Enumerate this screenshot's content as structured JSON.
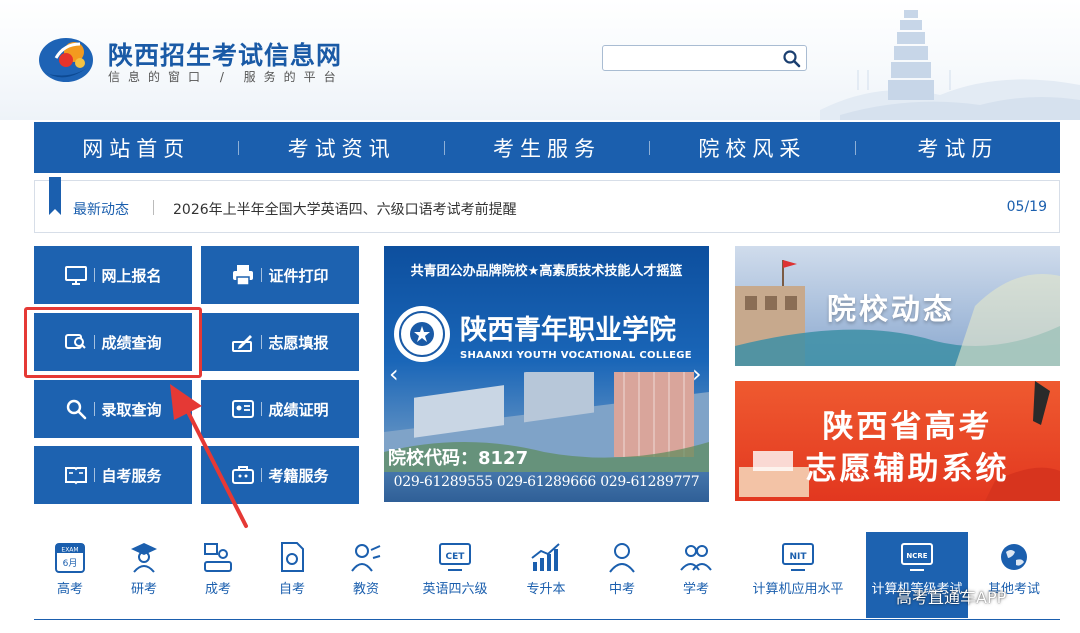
{
  "header": {
    "site_title": "陕西招生考试信息网",
    "slogan": "信息的窗口 / 服务的平台",
    "search_placeholder": ""
  },
  "nav": {
    "items": [
      {
        "label": "网站首页"
      },
      {
        "label": "考试资讯"
      },
      {
        "label": "考生服务"
      },
      {
        "label": "院校风采"
      },
      {
        "label": "考试历"
      }
    ]
  },
  "news": {
    "label": "最新动态",
    "title": "2026年上半年全国大学英语四、六级口语考试考前提醒",
    "date": "05/19"
  },
  "services": [
    {
      "label": "网上报名",
      "icon": "monitor-icon"
    },
    {
      "label": "证件打印",
      "icon": "printer-icon"
    },
    {
      "label": "成绩查询",
      "icon": "score-search-icon"
    },
    {
      "label": "志愿填报",
      "icon": "pen-form-icon"
    },
    {
      "label": "录取查询",
      "icon": "magnifier-icon"
    },
    {
      "label": "成绩证明",
      "icon": "certificate-icon"
    },
    {
      "label": "自考服务",
      "icon": "book-icon"
    },
    {
      "label": "考籍服务",
      "icon": "briefcase-icon"
    }
  ],
  "banner": {
    "tagline": "共青团公办品牌院校★高素质技术技能人才摇篮",
    "college_cn": "陕西青年职业学院",
    "college_en": "SHAANXI YOUTH VOCATIONAL COLLEGE",
    "code": "院校代码：8127",
    "phones": "029-61289555   029-61289666   029-61289777"
  },
  "promos": {
    "school_news": "院校动态",
    "volunteer_line1": "陕西省高考",
    "volunteer_line2": "志愿辅助系统"
  },
  "categories": [
    {
      "label": "高考",
      "icon": "calendar-exam-icon",
      "badge": "EXAM",
      "sub": "6月"
    },
    {
      "label": "研考",
      "icon": "graduate-icon"
    },
    {
      "label": "成考",
      "icon": "person-board-icon"
    },
    {
      "label": "自考",
      "icon": "document-icon"
    },
    {
      "label": "教资",
      "icon": "teacher-icon"
    },
    {
      "label": "英语四六级",
      "icon": "cet-icon",
      "badge": "CET"
    },
    {
      "label": "专升本",
      "icon": "growth-chart-icon"
    },
    {
      "label": "中考",
      "icon": "student-icon"
    },
    {
      "label": "学考",
      "icon": "students-icon"
    },
    {
      "label": "计算机应用水平",
      "icon": "nit-icon",
      "badge": "NIT"
    },
    {
      "label": "计算机等级考试",
      "icon": "ncre-icon",
      "badge": "NCRE"
    },
    {
      "label": "其他考试",
      "icon": "globe-icon"
    }
  ],
  "watermark": "高考直通车APP",
  "colors": {
    "primary": "#1b5fae",
    "tile": "#1d62b0",
    "highlight": "#e53935",
    "promo_orange": "#e84a26"
  }
}
